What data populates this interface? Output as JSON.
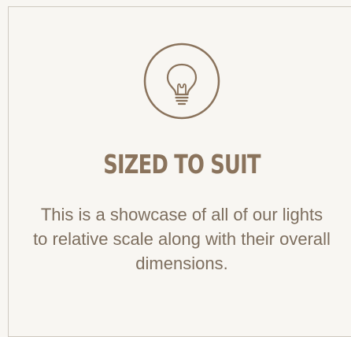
{
  "card": {
    "icon": "lightbulb-icon",
    "title": "SIZED TO SUIT",
    "description": "This is a showcase of all of our lights to relative scale along with their overall dimensions."
  },
  "colors": {
    "background": "#f8f6f2",
    "accent": "#8a735c",
    "text": "#7d6e5e",
    "border": "#cfc9c0"
  }
}
